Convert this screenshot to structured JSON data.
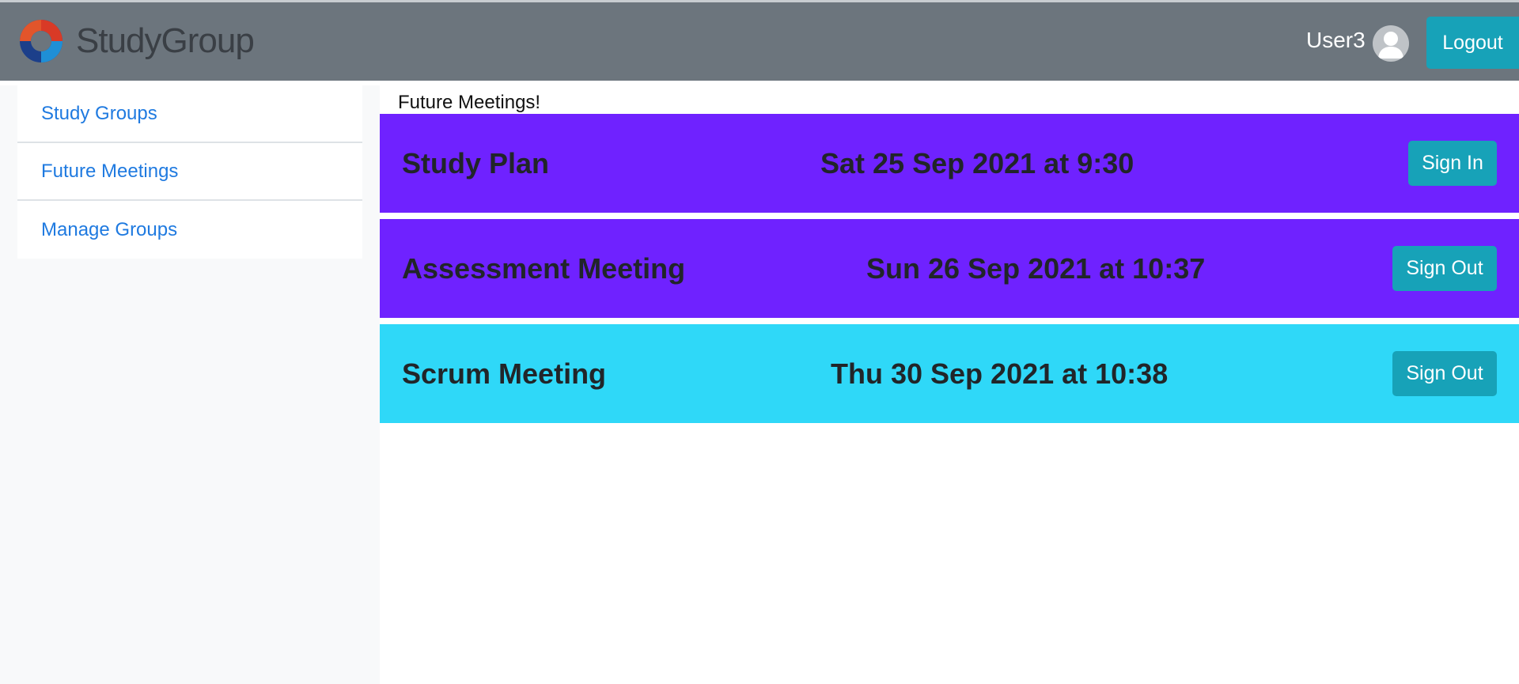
{
  "navbar": {
    "brand": "StudyGroup",
    "brand_logo_icon": "studygroup-logo-icon",
    "username": "User3",
    "avatar_icon": "user-avatar-icon",
    "logout_label": "Logout"
  },
  "sidebar": {
    "items": [
      {
        "label": "Study Groups"
      },
      {
        "label": "Future Meetings"
      },
      {
        "label": "Manage Groups"
      }
    ]
  },
  "main": {
    "heading": "Future Meetings!",
    "meetings": [
      {
        "title": "Study Plan",
        "date": "Sat 25 Sep 2021 at 9:30",
        "action": "Sign In",
        "color": "#6f22ff"
      },
      {
        "title": "Assessment Meeting",
        "date": "Sun 26 Sep 2021 at 10:37",
        "action": "Sign Out",
        "color": "#6f22ff"
      },
      {
        "title": "Scrum Meeting",
        "date": "Thu 30 Sep 2021 at 10:38",
        "action": "Sign Out",
        "color": "#2fd8f8"
      }
    ]
  },
  "colors": {
    "navbar_bg": "#6c757d",
    "accent_button": "#17a2b8",
    "link": "#1f7ae0"
  }
}
